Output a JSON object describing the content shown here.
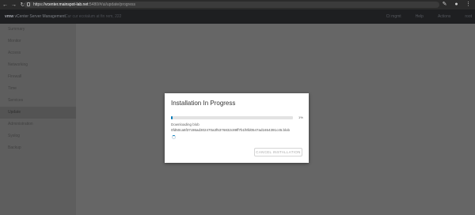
{
  "browser": {
    "url_prefix": "https://",
    "url_host": "vcenter.mainspot-lab.net",
    "url_path": ":5480/#/ui/update/progress",
    "back_icon": "arrow-left-icon",
    "forward_icon": "arrow-right-icon",
    "reload_icon": "reload-icon"
  },
  "header": {
    "app_prefix": "vmw",
    "app_title": "vCenter Server Management",
    "center_text": "Cur cur ecotalum at fin rem, 222",
    "menu": [
      "Ct mgmt",
      "Help",
      "Actions",
      "root"
    ]
  },
  "sidebar": {
    "items": [
      {
        "label": "Summary",
        "active": false
      },
      {
        "label": "Monitor",
        "active": false
      },
      {
        "label": "Access",
        "active": false
      },
      {
        "label": "Networking",
        "active": false
      },
      {
        "label": "Firewall",
        "active": false
      },
      {
        "label": "Time",
        "active": false
      },
      {
        "label": "Services",
        "active": false
      },
      {
        "label": "Update",
        "active": true
      },
      {
        "label": "Administration",
        "active": false
      },
      {
        "label": "Syslog",
        "active": false
      },
      {
        "label": "Backup",
        "active": false
      }
    ]
  },
  "modal": {
    "title": "Installation In Progress",
    "progress_percent": 1,
    "progress_label": "1%",
    "status": "Downloading blob",
    "blob_hash": "0fd50ca5f37c86ad302470a3f5376832c89ff7b1f8fd0547ad1654391c45.blob",
    "cancel_label": "CANCEL INSTALLATION",
    "accent_color": "#0079b8"
  }
}
